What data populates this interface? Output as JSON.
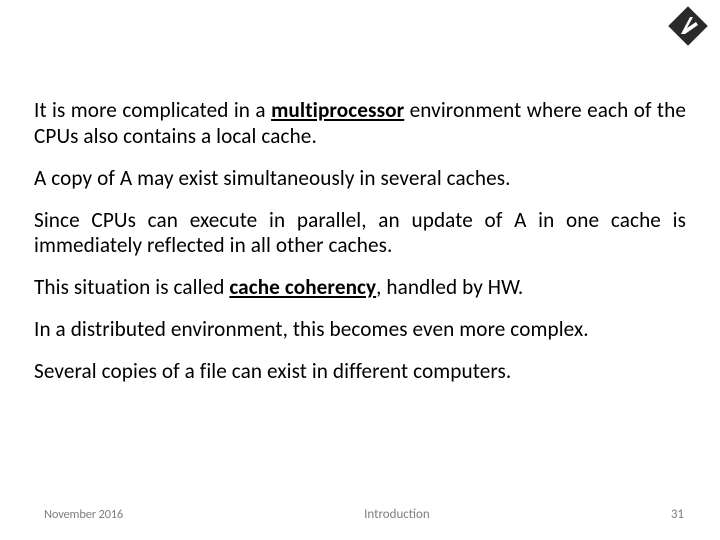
{
  "body": {
    "p1_a": "It is more complicated in a ",
    "p1_b": "multiprocessor",
    "p1_c": " environment where each of the CPUs also contains a local cache.",
    "p2": "A copy of A may exist simultaneously in several caches.",
    "p3": "Since CPUs can execute in parallel, an update of A in one cache is immediately reflected in all other caches.",
    "p4_a": "This situation is called ",
    "p4_b": "cache coherency",
    "p4_c": ", handled by HW.",
    "p5": "In a distributed environment, this becomes even more complex.",
    "p6": "Several copies of a file can exist in different computers."
  },
  "footer": {
    "date": "November 2016",
    "title": "Introduction",
    "page": "31"
  }
}
